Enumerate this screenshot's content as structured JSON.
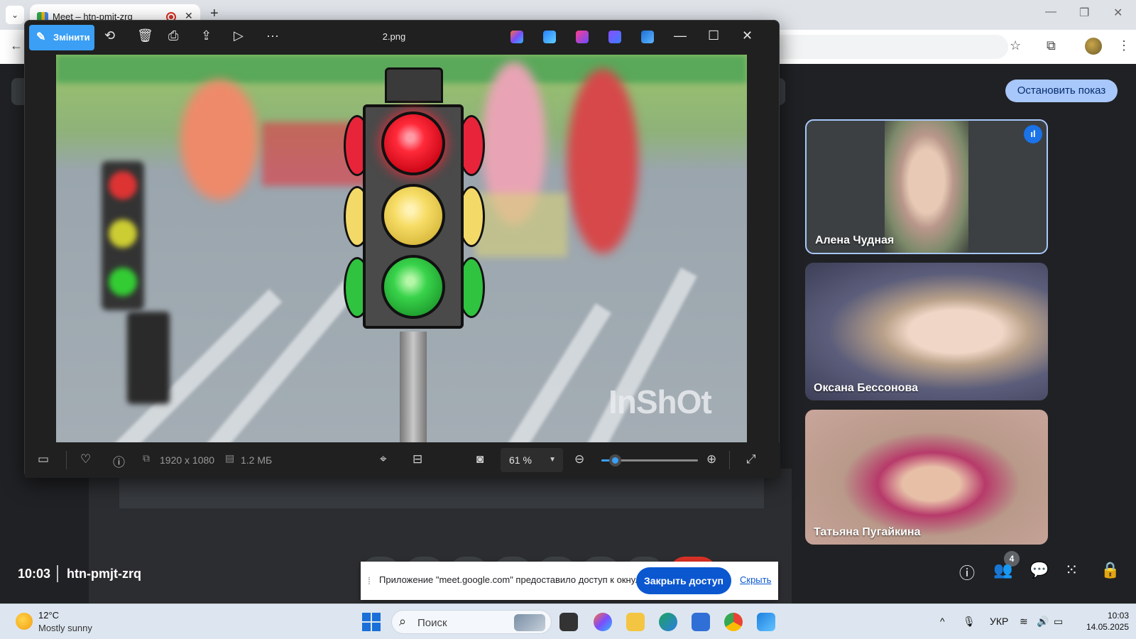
{
  "browser": {
    "tab_title": "Meet – htn-pmjt-zrq",
    "tab_close": "✕",
    "new_tab": "+"
  },
  "meet": {
    "stop_presenting": "Остановить показ",
    "time": "10:03",
    "meeting_code": "htn-pmjt-zrq",
    "participant_count": "4",
    "participants": [
      {
        "name": "Алена Чудная",
        "speaking": true
      },
      {
        "name": "Оксана Бессонова",
        "speaking": false
      },
      {
        "name": "Татьяна Пугайкина",
        "speaking": false
      }
    ],
    "share_notice": {
      "message": "Приложение \"meet.google.com\" предоставило доступ к окну.",
      "stop_sharing": "Закрыть доступ",
      "hide": "Скрыть"
    }
  },
  "viewer": {
    "edit_label": "Змінити",
    "file_name": "2.png",
    "dimensions": "1920 x 1080",
    "file_size": "1.2 МБ",
    "zoom": "61 %",
    "zoom_level": 0.14,
    "watermark": "InShOt"
  },
  "taskbar": {
    "temperature": "12°C",
    "weather": "Mostly sunny",
    "search_placeholder": "Поиск",
    "language": "УКР",
    "time": "10:03",
    "date": "14.05.2025"
  },
  "colors": {
    "meet_bg": "#202124",
    "accent_blue": "#0b57d0",
    "viewer_accent": "#3a9ff5",
    "stop_button": "#a8c7fa"
  }
}
